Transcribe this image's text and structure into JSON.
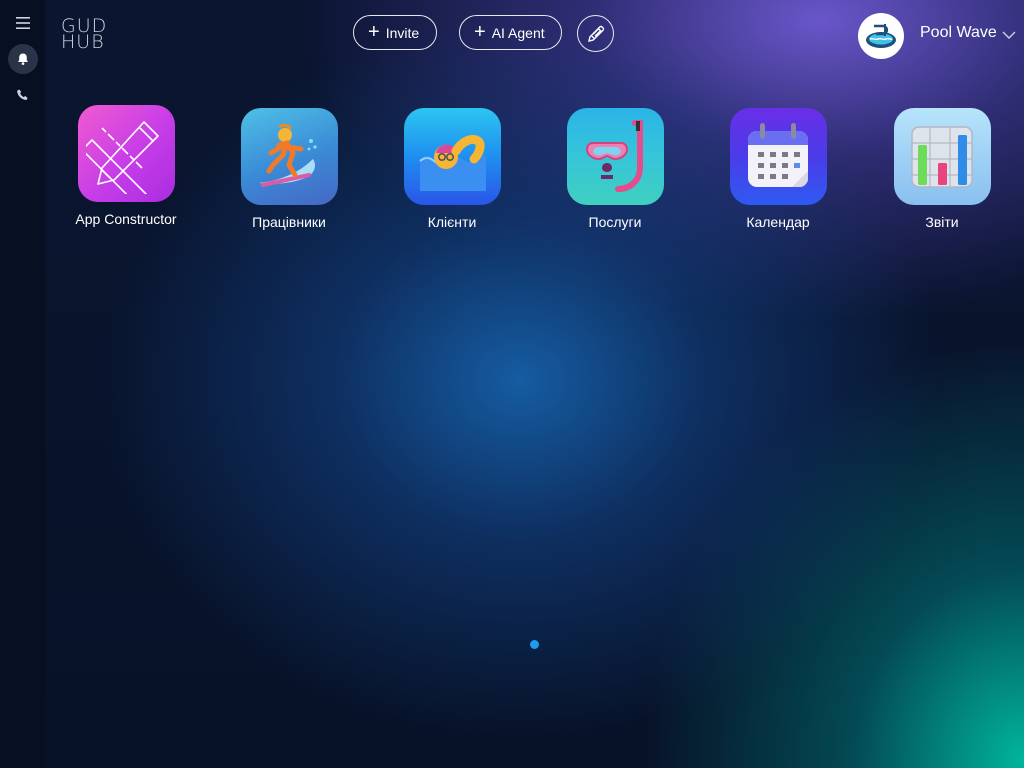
{
  "logo": {
    "line1": "GUD",
    "line2": "HUB"
  },
  "sidebar": {
    "items": [
      {
        "icon": "menu-icon"
      },
      {
        "icon": "bell-icon",
        "active": true
      },
      {
        "icon": "phone-icon"
      }
    ]
  },
  "header": {
    "invite_label": "Invite",
    "ai_agent_label": "AI Agent",
    "edit_icon": "pencil-icon"
  },
  "user": {
    "name": "Pool Wave",
    "avatar_icon": "pool-logo-icon"
  },
  "apps": [
    {
      "label": "App Constructor",
      "icon": "ruler-pencil-icon",
      "color": "#c63de8"
    },
    {
      "label": "Працівники",
      "icon": "surfer-icon",
      "color": "#3a7fd0"
    },
    {
      "label": "Клієнти",
      "icon": "swimmer-icon",
      "color": "#1f6ff0"
    },
    {
      "label": "Послуги",
      "icon": "snorkel-mask-icon",
      "color": "#2aa6d8"
    },
    {
      "label": "Календар",
      "icon": "calendar-icon",
      "color": "#4a3ce8"
    },
    {
      "label": "Звіти",
      "icon": "bar-chart-icon",
      "color": "#8fc0f2"
    }
  ],
  "pager": {
    "current": 1,
    "total": 1
  }
}
